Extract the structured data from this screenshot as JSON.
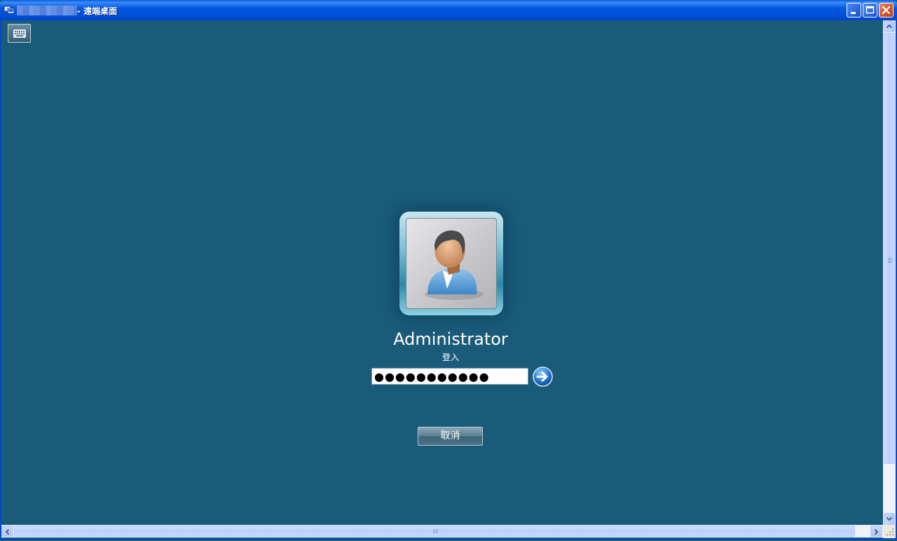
{
  "window": {
    "title": "- 遠端桌面",
    "controls": [
      "minimize-icon",
      "maximize-icon",
      "close-icon"
    ]
  },
  "toolbar": {
    "keyboard_icon": "keyboard-icon"
  },
  "login": {
    "username": "Administrator",
    "status": "登入",
    "password_value": "●●●●●●●●●●●",
    "submit_icon": "arrow-right-icon",
    "cancel_label": "取消"
  },
  "colors": {
    "desktop_bg": "#1a5b7a",
    "titlebar": "#0058e0",
    "close_button": "#d6542c"
  }
}
